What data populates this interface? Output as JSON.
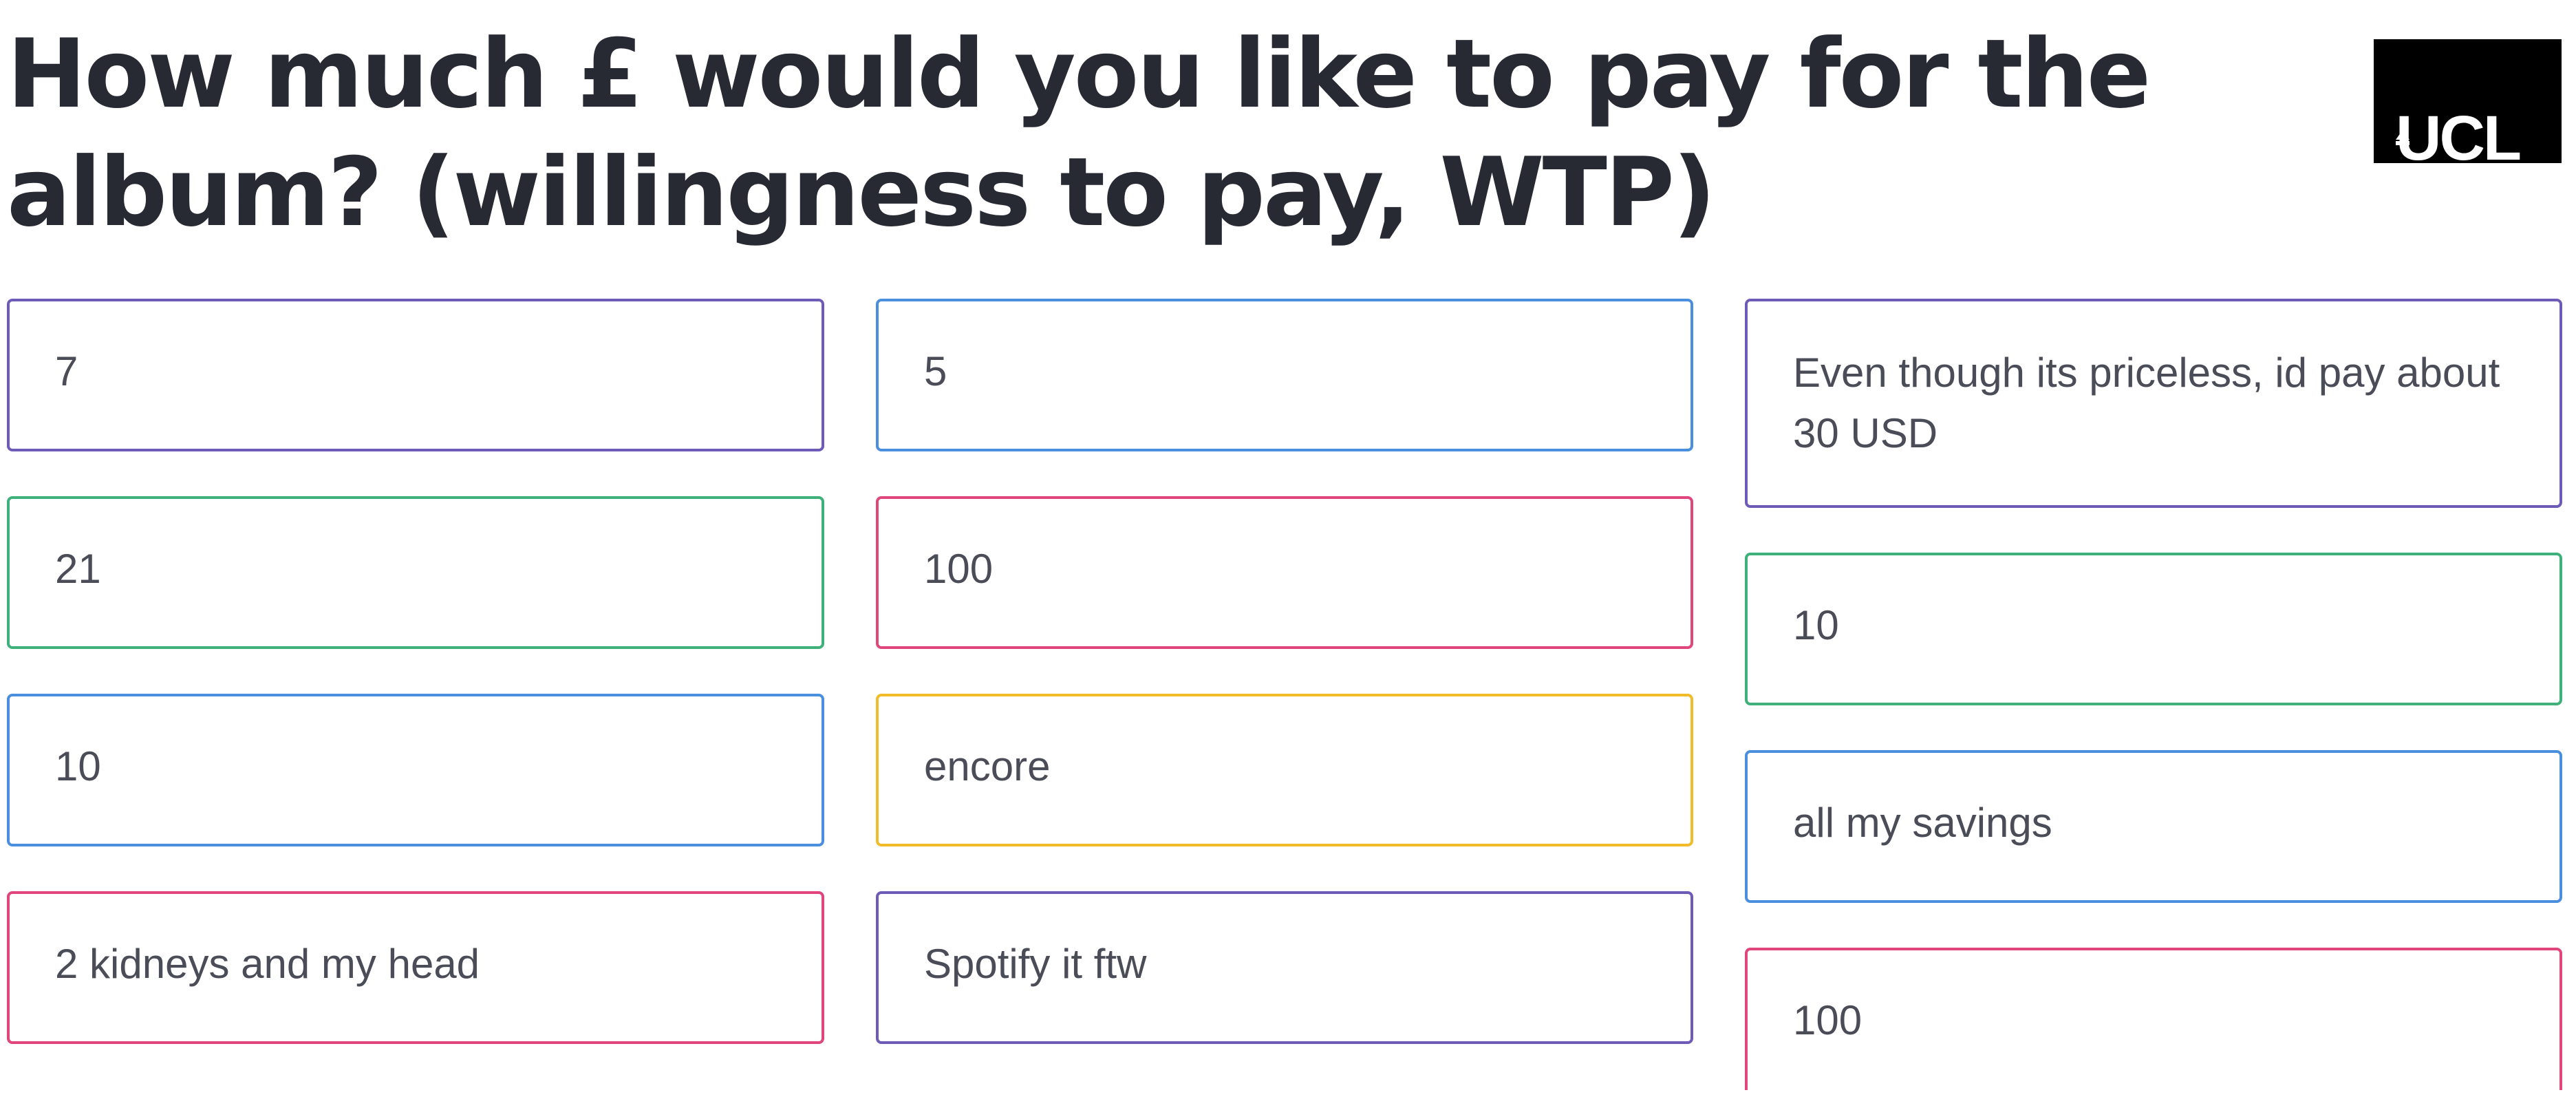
{
  "question": {
    "title": "How much £ would you like to pay for the album? (willingness to pay, WTP)"
  },
  "logo": {
    "text": "UCL"
  },
  "colors": {
    "purple": "#6e5bb8",
    "blue": "#4a8fdd",
    "green": "#3fb07a",
    "pink": "#e0467b",
    "yellow": "#f2bb2a"
  },
  "responses": {
    "column_1": [
      {
        "text": "7",
        "border_color": "#6e5bb8"
      },
      {
        "text": "21",
        "border_color": "#3fb07a"
      },
      {
        "text": "10",
        "border_color": "#4a8fdd"
      },
      {
        "text": "2 kidneys and my head",
        "border_color": "#e0467b"
      }
    ],
    "column_2": [
      {
        "text": "5",
        "border_color": "#4a8fdd"
      },
      {
        "text": "100",
        "border_color": "#e0467b"
      },
      {
        "text": "encore",
        "border_color": "#f2bb2a"
      },
      {
        "text": "Spotify it ftw",
        "border_color": "#6e5bb8"
      }
    ],
    "column_3": [
      {
        "text": "Even though its priceless, id pay about 30 USD",
        "border_color": "#6e5bb8"
      },
      {
        "text": "10",
        "border_color": "#3fb07a"
      },
      {
        "text": "all my savings",
        "border_color": "#4a8fdd"
      },
      {
        "text": "100",
        "border_color": "#e0467b"
      }
    ]
  }
}
